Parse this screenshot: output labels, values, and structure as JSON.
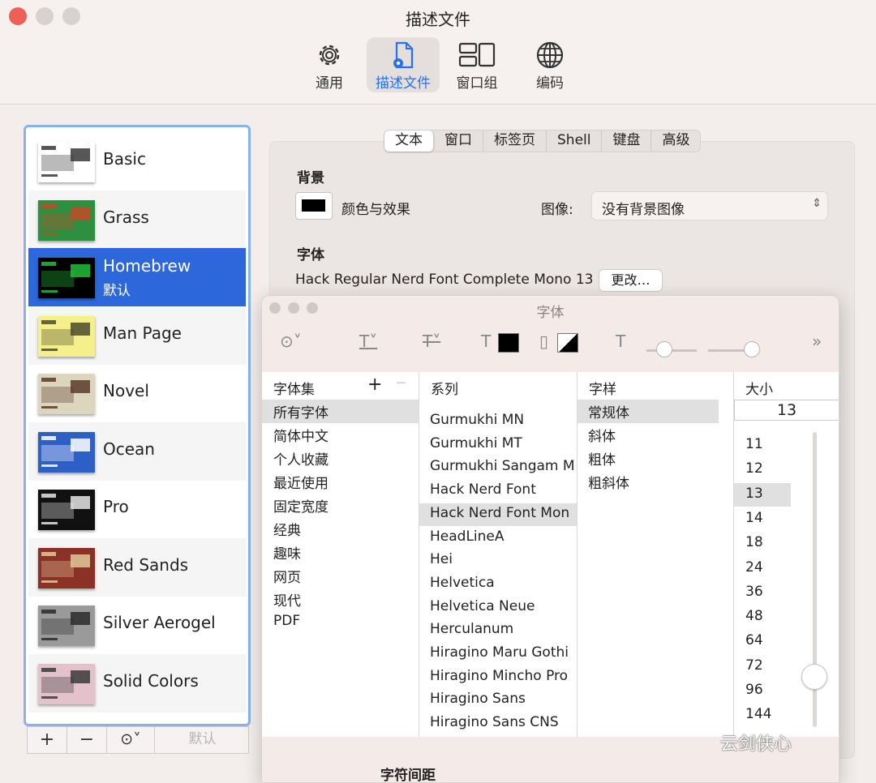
{
  "window": {
    "title": "描述文件",
    "lights": [
      {
        "color": "#ee5f57"
      },
      {
        "color": "#d7d2d0"
      },
      {
        "color": "#d7d2d0"
      }
    ]
  },
  "toolbar": {
    "tabs": [
      {
        "label": "通用",
        "icon": "gear-icon",
        "selected": false
      },
      {
        "label": "描述文件",
        "icon": "profile-doc-icon",
        "selected": true
      },
      {
        "label": "窗口组",
        "icon": "window-group-icon",
        "selected": false
      },
      {
        "label": "编码",
        "icon": "globe-icon",
        "selected": false
      }
    ]
  },
  "profiles": {
    "items": [
      {
        "name": "Basic",
        "thumb_bg": "#ffffff",
        "thumb_accent": "#3a3a3a",
        "selected": false
      },
      {
        "name": "Grass",
        "thumb_bg": "#2f8f40",
        "thumb_accent": "#c44a2a",
        "selected": false
      },
      {
        "name": "Homebrew",
        "subtitle": "默认",
        "thumb_bg": "#000000",
        "thumb_accent": "#1fbf3a",
        "selected": true
      },
      {
        "name": "Man Page",
        "thumb_bg": "#f6f08c",
        "thumb_accent": "#4a4a2a",
        "selected": false
      },
      {
        "name": "Novel",
        "thumb_bg": "#ddd6bf",
        "thumb_accent": "#5a3a2a",
        "selected": false
      },
      {
        "name": "Ocean",
        "thumb_bg": "#2e5fc8",
        "thumb_accent": "#ffffff",
        "selected": false
      },
      {
        "name": "Pro",
        "thumb_bg": "#111111",
        "thumb_accent": "#e6e6e6",
        "selected": false
      },
      {
        "name": "Red Sands",
        "thumb_bg": "#8a3226",
        "thumb_accent": "#e0c89a",
        "selected": false
      },
      {
        "name": "Silver Aerogel",
        "thumb_bg": "#9a9a9a",
        "thumb_accent": "#2a2a2a",
        "selected": false
      },
      {
        "name": "Solid Colors",
        "thumb_bg": "#e3c2cc",
        "thumb_accent": "#3a3a3a",
        "selected": false
      }
    ],
    "footer": {
      "add": "+",
      "remove": "−",
      "more": "⊙˅",
      "default": "默认"
    }
  },
  "settings": {
    "tabs": [
      {
        "label": "文本",
        "active": true
      },
      {
        "label": "窗口",
        "active": false
      },
      {
        "label": "标签页",
        "active": false
      },
      {
        "label": "Shell",
        "active": false
      },
      {
        "label": "键盘",
        "active": false
      },
      {
        "label": "高级",
        "active": false
      }
    ],
    "background": {
      "heading": "背景",
      "color_effect_label": "颜色与效果",
      "image_label": "图像:",
      "image_value": "没有背景图像"
    },
    "font": {
      "heading": "字体",
      "current": "Hack Regular Nerd Font Complete Mono 13",
      "change_button": "更改…"
    }
  },
  "font_panel": {
    "title": "字体",
    "columns": {
      "collections": "字体集",
      "family": "系列",
      "typeface": "字样",
      "size": "大小"
    },
    "add_collection": "+",
    "remove_collection": "−",
    "collections": [
      "所有字体",
      "简体中文",
      "个人收藏",
      "最近使用",
      "固定宽度",
      "经典",
      "趣味",
      "网页",
      "现代",
      "PDF"
    ],
    "selected_collection": "所有字体",
    "families": [
      "Gurmukhi MN",
      "Gurmukhi MT",
      "Gurmukhi Sangam M",
      "Hack Nerd Font",
      "Hack Nerd Font Mon",
      "HeadLineA",
      "Hei",
      "Helvetica",
      "Helvetica Neue",
      "Herculanum",
      "Hiragino Maru Gothi",
      "Hiragino Mincho Pro",
      "Hiragino Sans",
      "Hiragino Sans CNS"
    ],
    "selected_family": "Hack Nerd Font Mon",
    "typefaces": [
      "常规体",
      "斜体",
      "粗体",
      "粗斜体"
    ],
    "selected_typeface": "常规体",
    "size_value": "13",
    "sizes": [
      "11",
      "12",
      "13",
      "14",
      "18",
      "24",
      "36",
      "48",
      "64",
      "72",
      "96",
      "144"
    ],
    "selected_size": "13",
    "spacing_label": "字符间距",
    "color_swatch": "#000000"
  },
  "watermark": "云剑侠心"
}
